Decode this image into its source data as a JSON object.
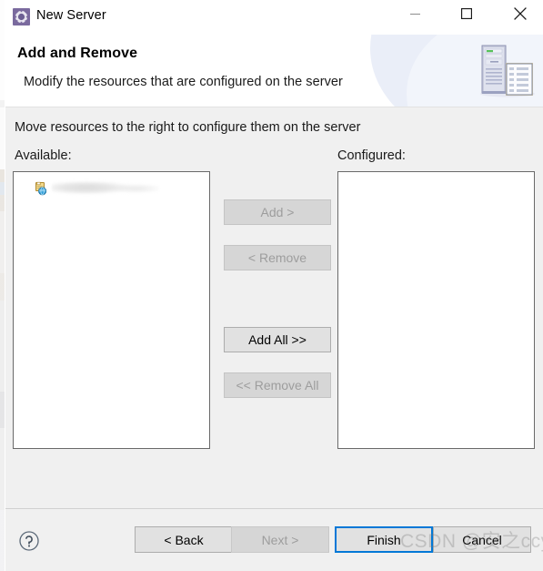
{
  "window": {
    "title": "New Server",
    "icon": "server-wizard-icon",
    "controls": {
      "minimize": "minimize-icon",
      "maximize": "maximize-icon",
      "close": "close-icon"
    }
  },
  "header": {
    "title": "Add and Remove",
    "subtitle": "Modify the resources that are configured on the server",
    "art": "server-and-document-icon"
  },
  "body": {
    "instruction": "Move resources to the right to configure them on the server",
    "available": {
      "label": "Available:",
      "items": [
        {
          "icon": "web-project-icon",
          "label": ""
        }
      ]
    },
    "configured": {
      "label": "Configured:",
      "items": []
    },
    "transfer_buttons": [
      {
        "label": "Add >",
        "enabled": false
      },
      {
        "label": "< Remove",
        "enabled": false
      },
      {
        "label": "Add All >>",
        "enabled": true
      },
      {
        "label": "<< Remove All",
        "enabled": false
      }
    ]
  },
  "footer": {
    "help": "help-icon",
    "buttons": [
      {
        "label": "< Back",
        "enabled": true,
        "default": false
      },
      {
        "label": "Next >",
        "enabled": false,
        "default": false
      },
      {
        "label": "Finish",
        "enabled": true,
        "default": true
      },
      {
        "label": "Cancel",
        "enabled": true,
        "default": false
      }
    ]
  },
  "watermark": "CSDN @安之ccy",
  "colors": {
    "accent": "#0078d7",
    "dialog_bg": "#f0f0f0",
    "header_bg": "#ffffff",
    "button_bg": "#e1e1e1",
    "button_border": "#adadad",
    "disabled_text": "#9d9d9d",
    "listbox_border": "#696969"
  }
}
